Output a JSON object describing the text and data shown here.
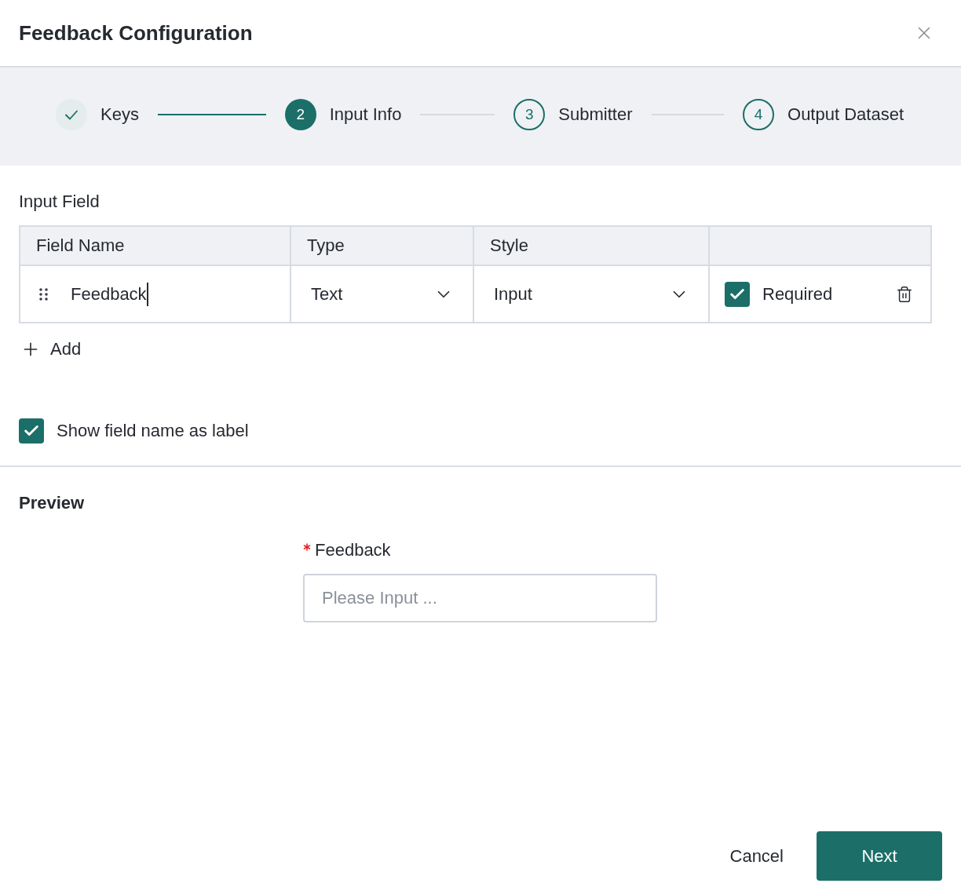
{
  "dialog": {
    "title": "Feedback Configuration"
  },
  "steps": [
    {
      "label": "Keys",
      "done": true,
      "selected": false
    },
    {
      "label": "Input Info",
      "number": "2",
      "done": false,
      "selected": true
    },
    {
      "label": "Submitter",
      "number": "3",
      "done": false,
      "selected": false
    },
    {
      "label": "Output Dataset",
      "number": "4",
      "done": false,
      "selected": false
    }
  ],
  "input_field": {
    "title": "Input Field",
    "columns": [
      "Field Name",
      "Type",
      "Style"
    ],
    "rows": [
      {
        "field_name": "Feedback",
        "focused": true,
        "type": "Text",
        "style": "Input",
        "required_label": "Required",
        "required": true
      }
    ],
    "add_label": "Add"
  },
  "show_field_name_as_label": {
    "label": "Show field name as label",
    "checked": true
  },
  "preview": {
    "title": "Preview",
    "field": {
      "label": "Feedback",
      "required": true,
      "placeholder": "Please Input ..."
    }
  },
  "buttons": [
    {
      "label": "Cancel",
      "kind": "text"
    },
    {
      "label": "Next",
      "kind": "primary"
    }
  ]
}
